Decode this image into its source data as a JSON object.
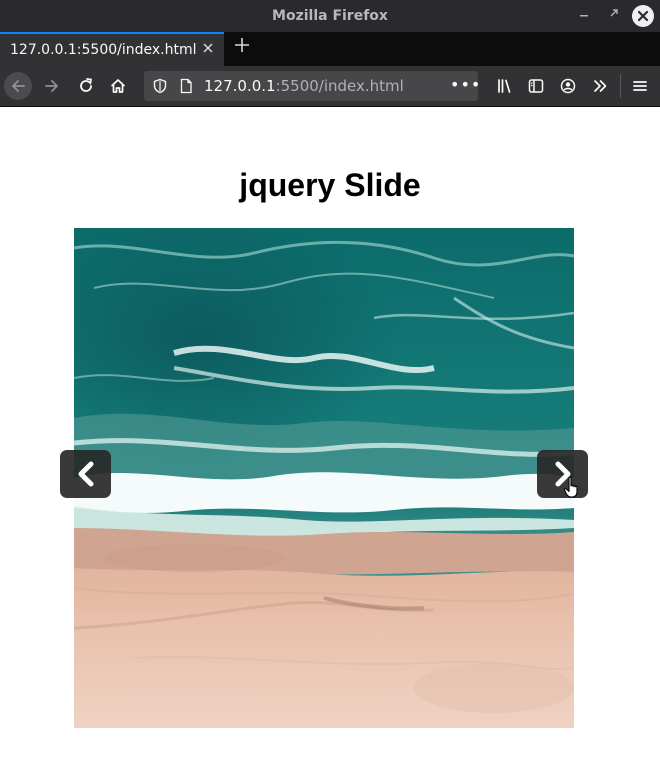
{
  "window": {
    "title": "Mozilla Firefox"
  },
  "tabs": [
    {
      "label": "127.0.0.1:5500/index.html"
    }
  ],
  "urlbar": {
    "host": "127.0.0.1",
    "rest": ":5500/index.html",
    "more": "•••"
  },
  "icons": {
    "back": "back-arrow-icon",
    "forward": "forward-arrow-icon",
    "reload": "reload-icon",
    "home": "home-icon",
    "library": "library-icon",
    "sidebar": "sidebar-icon",
    "account": "account-icon",
    "overflow": "overflow-chevron-icon",
    "menu": "hamburger-menu-icon"
  },
  "page": {
    "heading": "jquery Slide"
  },
  "slider": {
    "image": "aerial ocean waves meeting sandy beach",
    "prev_icon": "chevron-left-icon",
    "next_icon": "chevron-right-icon"
  },
  "colors": {
    "chrome_dark": "#2a2a2e",
    "tab_active_accent": "#0a84ff",
    "arrow_bg": "#282828"
  }
}
